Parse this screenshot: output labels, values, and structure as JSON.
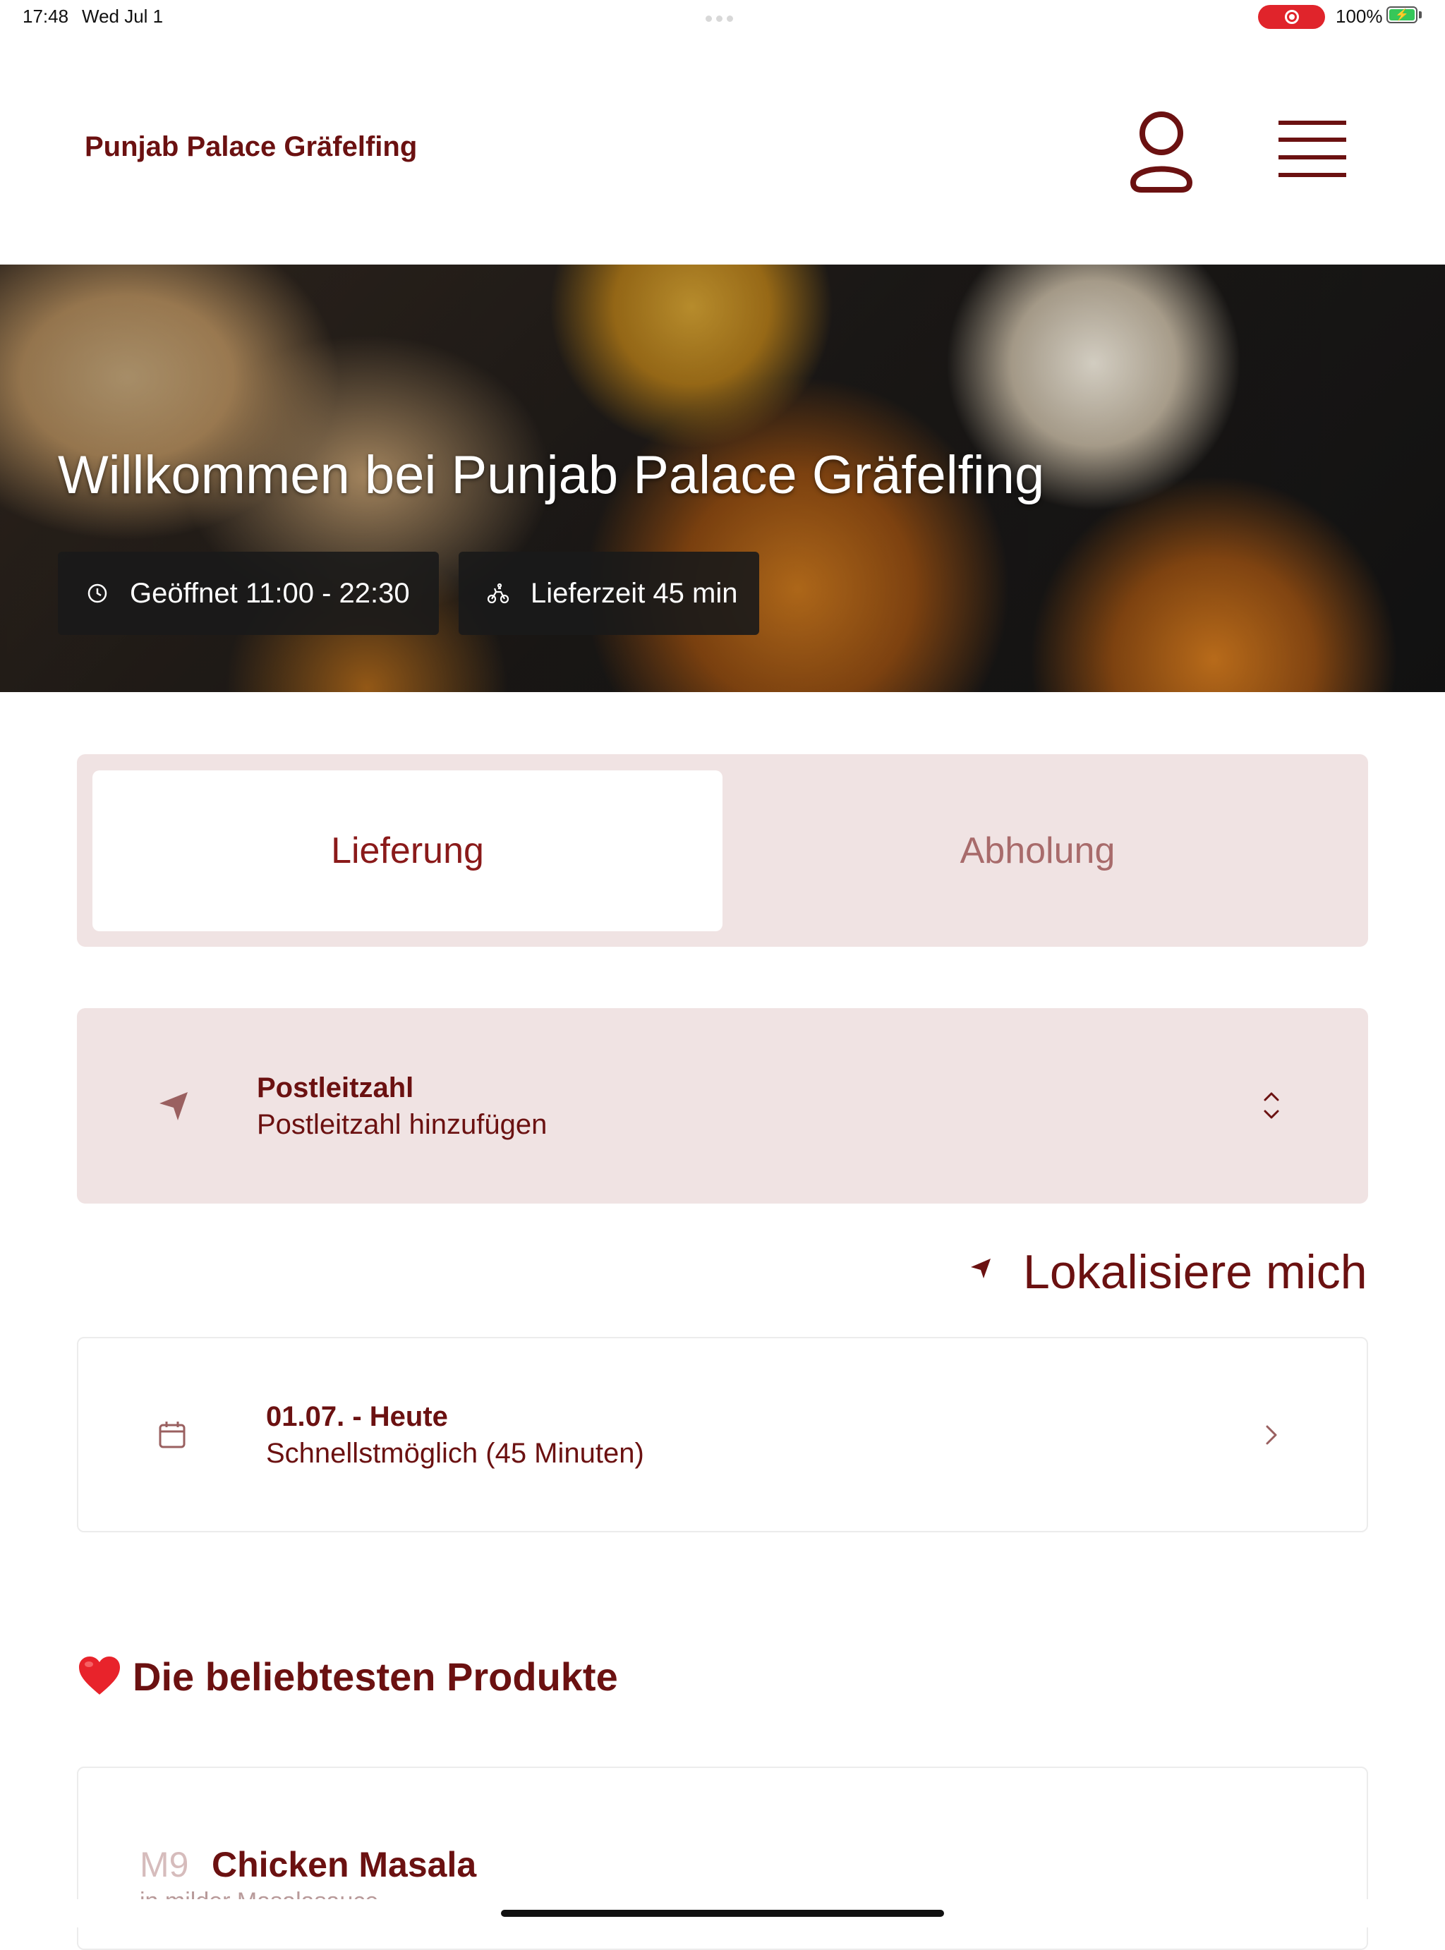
{
  "status_bar": {
    "time": "17:48",
    "date": "Wed Jul 1",
    "battery": "100%",
    "record_color": "#e0242b"
  },
  "header": {
    "brand": "Punjab Palace Gräfelfing",
    "profile_icon": "person-icon",
    "menu_icon": "hamburger-menu-icon"
  },
  "hero": {
    "title": "Willkommen bei Punjab Palace Gräfelfing",
    "hours": "Geöffnet 11:00 - 22:30",
    "delivery_time": "Lieferzeit 45 min",
    "hours_icon": "clock-icon",
    "delivery_icon": "bicycle-icon"
  },
  "order_mode": {
    "options": [
      "Lieferung",
      "Abholung"
    ],
    "selected": "Lieferung"
  },
  "postal": {
    "title": "Postleitzahl",
    "placeholder": "Postleitzahl hinzufügen",
    "icon": "location-arrow-icon"
  },
  "locate": {
    "label": "Lokalisiere mich"
  },
  "schedule": {
    "date": "01.07. - Heute",
    "time": "Schnellstmöglich (45 Minuten)",
    "icon": "calendar-icon"
  },
  "popular": {
    "title": "Die beliebtesten Produkte",
    "items": [
      {
        "code": "M9",
        "name": "Chicken Masala",
        "description": "in milder Masalasauce"
      }
    ]
  },
  "colors": {
    "brand": "#6b1111",
    "panel": "#f0e3e3"
  }
}
